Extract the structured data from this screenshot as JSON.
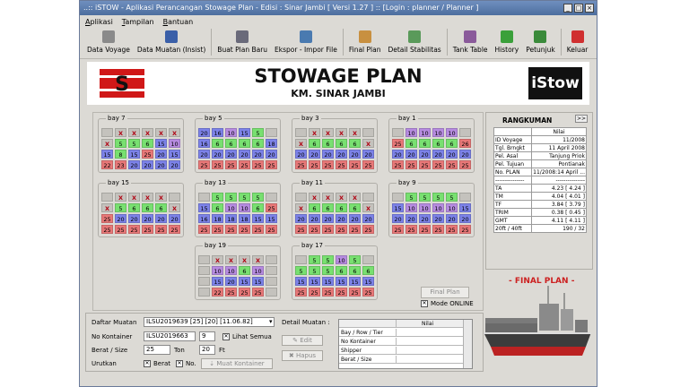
{
  "window": {
    "title": "..:: iSTOW - Aplikasi Perancangan Stowage Plan - Edisi : Sinar Jambi [ Versi 1.27 ] :: [Login : planner / Planner ]"
  },
  "menu": [
    "Aplikasi",
    "Tampilan",
    "Bantuan"
  ],
  "toolbar": [
    {
      "label": "Data Voyage",
      "icon": "ship-icon",
      "color": "#8a8a8a"
    },
    {
      "label": "Data Muatan (Insist)",
      "icon": "containers-icon",
      "color": "#3a5fa8"
    },
    {
      "label": "Buat Plan Baru",
      "icon": "new-plan-icon",
      "color": "#6a6a7a"
    },
    {
      "label": "Ekspor - Impor File",
      "icon": "export-import-icon",
      "color": "#4a7ab0"
    },
    {
      "label": "Final Plan",
      "icon": "final-plan-icon",
      "color": "#c89040"
    },
    {
      "label": "Detail Stabilitas",
      "icon": "stability-icon",
      "color": "#5a9a5a"
    },
    {
      "label": "Tank Table",
      "icon": "tank-icon",
      "color": "#8a5a9a"
    },
    {
      "label": "History",
      "icon": "history-icon",
      "color": "#3aa03a"
    },
    {
      "label": "Petunjuk",
      "icon": "help-icon",
      "color": "#3a8a3a"
    },
    {
      "label": "Keluar",
      "icon": "exit-icon",
      "color": "#d03030"
    }
  ],
  "header": {
    "title": "STOWAGE PLAN",
    "subtitle": "KM. SINAR JAMBI",
    "brand": "iStow",
    "logo_letter": "S"
  },
  "bays": [
    {
      "label": "bay 7",
      "rows": [
        [
          "",
          "X",
          "X",
          "X",
          "X",
          "X"
        ],
        [
          "X",
          "5",
          "5",
          "6",
          "15",
          "10"
        ],
        [
          "15",
          "8",
          "15",
          "25",
          "20",
          "15"
        ],
        [
          "22",
          "23",
          "20",
          "20",
          "20",
          "20"
        ]
      ]
    },
    {
      "label": "bay 5",
      "rows": [
        [
          "20",
          "16",
          "10",
          "15",
          "5",
          ""
        ],
        [
          "16",
          "6",
          "6",
          "6",
          "6",
          "18"
        ],
        [
          "20",
          "20",
          "20",
          "20",
          "20",
          "20"
        ],
        [
          "25",
          "25",
          "25",
          "25",
          "25",
          "25"
        ]
      ]
    },
    {
      "label": "bay 3",
      "rows": [
        [
          "",
          "X",
          "X",
          "X",
          "X",
          ""
        ],
        [
          "X",
          "6",
          "6",
          "6",
          "6",
          "X"
        ],
        [
          "20",
          "20",
          "20",
          "20",
          "20",
          "20"
        ],
        [
          "25",
          "25",
          "25",
          "25",
          "25",
          "25"
        ]
      ]
    },
    {
      "label": "bay 1",
      "rows": [
        [
          "",
          "10",
          "10",
          "10",
          "10",
          ""
        ],
        [
          "25",
          "6",
          "6",
          "6",
          "6",
          "26"
        ],
        [
          "20",
          "20",
          "20",
          "20",
          "20",
          "20"
        ],
        [
          "25",
          "25",
          "25",
          "25",
          "25",
          "25"
        ]
      ]
    },
    {
      "label": "bay 15",
      "rows": [
        [
          "",
          "X",
          "X",
          "X",
          "X",
          ""
        ],
        [
          "X",
          "5",
          "6",
          "6",
          "6",
          "X"
        ],
        [
          "25",
          "20",
          "20",
          "20",
          "20",
          "20"
        ],
        [
          "25",
          "25",
          "25",
          "25",
          "25",
          "25"
        ]
      ]
    },
    {
      "label": "bay 13",
      "rows": [
        [
          "",
          "5",
          "5",
          "5",
          "5",
          ""
        ],
        [
          "15",
          "6",
          "10",
          "10",
          "6",
          "25"
        ],
        [
          "16",
          "18",
          "18",
          "18",
          "15",
          "15"
        ],
        [
          "25",
          "25",
          "25",
          "25",
          "25",
          "25"
        ]
      ]
    },
    {
      "label": "bay 11",
      "rows": [
        [
          "",
          "X",
          "X",
          "X",
          "X",
          ""
        ],
        [
          "X",
          "6",
          "6",
          "6",
          "6",
          "X"
        ],
        [
          "20",
          "20",
          "20",
          "20",
          "20",
          "20"
        ],
        [
          "25",
          "25",
          "25",
          "25",
          "25",
          "25"
        ]
      ]
    },
    {
      "label": "bay 9",
      "rows": [
        [
          "",
          "5",
          "5",
          "5",
          "5",
          ""
        ],
        [
          "15",
          "10",
          "10",
          "10",
          "10",
          "15"
        ],
        [
          "20",
          "20",
          "20",
          "20",
          "20",
          "20"
        ],
        [
          "25",
          "25",
          "25",
          "25",
          "25",
          "25"
        ]
      ]
    },
    {
      "label": "bay 19",
      "rows": [
        [
          "",
          "X",
          "X",
          "X",
          "X",
          ""
        ],
        [
          "",
          "10",
          "10",
          "6",
          "10",
          ""
        ],
        [
          "",
          "15",
          "20",
          "15",
          "15",
          ""
        ],
        [
          "",
          "22",
          "25",
          "25",
          "25",
          ""
        ]
      ]
    },
    {
      "label": "bay 17",
      "rows": [
        [
          "",
          "5",
          "5",
          "10",
          "5",
          ""
        ],
        [
          "5",
          "5",
          "5",
          "6",
          "6",
          "6"
        ],
        [
          "15",
          "15",
          "15",
          "15",
          "15",
          "15"
        ],
        [
          "25",
          "25",
          "25",
          "25",
          "25",
          "25"
        ]
      ]
    }
  ],
  "cell_colors": {
    "green": "#78e070",
    "blue": "#7c82e8",
    "red": "#e87878",
    "pink": "#e7a6c5",
    "violet": "#b68be0",
    "empty": "#c4c2bd",
    "x_mark": "#b00010"
  },
  "final_plan_button": "Final Plan",
  "mode_online": "Mode ONLINE",
  "rangkuman": {
    "title": "RANGKUMAN",
    "more": ">>",
    "header": "Nilai",
    "rows": [
      [
        "ID Voyage",
        "11/2008"
      ],
      [
        "Tgl. Brngkt",
        "11 April 2008"
      ],
      [
        "Pel. Asal",
        "Tanjung Priok"
      ],
      [
        "Pel. Tujuan",
        "Pontianak"
      ],
      [
        "No. PLAN",
        "11/2008:14 April ..."
      ],
      [
        "---------------",
        "---------------"
      ],
      [
        "TA",
        "4.23 [ 4.24 ]"
      ],
      [
        "TM",
        "4.04 [ 4.01 ]"
      ],
      [
        "TF",
        "3.84 [ 3.79 ]"
      ],
      [
        "TRIM",
        "0.38 [ 0.45 ]"
      ],
      [
        "GMT",
        "4.11 [ 4.11 ]"
      ],
      [
        "20ft / 40ft",
        "190 / 32"
      ]
    ]
  },
  "final_plan_label": "- FINAL PLAN -",
  "cargo": {
    "daftar_label": "Daftar Muatan",
    "daftar_value": "ILSU2019639 [25] [20] [11.06.82]",
    "nokontainer_label": "No Kontainer",
    "nokontainer_value": "ILSU2019663",
    "nokontainer_num": "9",
    "lihat_semua": "Lihat Semua",
    "berat_label": "Berat / Size",
    "berat_value": "25",
    "ton": "Ton",
    "size_value": "20",
    "ft": "Ft",
    "urutkan_label": "Urutkan",
    "sort_berat": "Berat",
    "sort_no": "No.",
    "muat_button": "Muat Kontainer",
    "detail_label": "Detail Muatan :",
    "edit_button": "Edit",
    "hapus_button": "Hapus",
    "detail_header": "Nilai",
    "detail_rows": [
      "Bay / Row / Tier",
      "No Kontainer",
      "Shipper",
      "Berat / Size"
    ]
  }
}
